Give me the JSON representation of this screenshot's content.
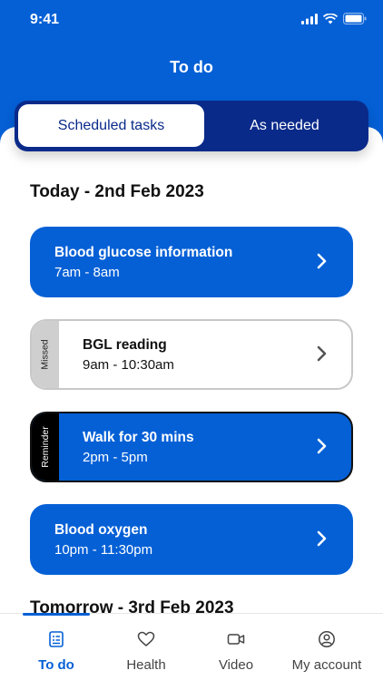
{
  "status_bar": {
    "time": "9:41"
  },
  "header": {
    "title": "To do"
  },
  "segmented": {
    "active_label": "Scheduled tasks",
    "inactive_label": "As needed"
  },
  "sections": [
    {
      "title": "Today - 2nd Feb 2023"
    },
    {
      "title": "Tomorrow - 3rd Feb 2023"
    }
  ],
  "tasks": [
    {
      "title": "Blood glucose information",
      "time": "7am - 8am",
      "style": "normal"
    },
    {
      "title": "BGL reading",
      "time": "9am - 10:30am",
      "style": "missed",
      "tag": "Missed"
    },
    {
      "title": "Walk for 30 mins",
      "time": "2pm - 5pm",
      "style": "reminder",
      "tag": "Reminder"
    },
    {
      "title": "Blood oxygen",
      "time": "10pm - 11:30pm",
      "style": "normal"
    }
  ],
  "tabbar": {
    "items": [
      {
        "label": "To do",
        "icon": "checklist-icon",
        "active": true
      },
      {
        "label": "Health",
        "icon": "heart-icon",
        "active": false
      },
      {
        "label": "Video",
        "icon": "video-camera-icon",
        "active": false
      },
      {
        "label": "My account",
        "icon": "account-icon",
        "active": false
      }
    ]
  },
  "colors": {
    "primary": "#0560d6",
    "segment_bg": "#0a2a8a",
    "missed_tag": "#cfcfcf",
    "reminder_tag": "#000000"
  }
}
